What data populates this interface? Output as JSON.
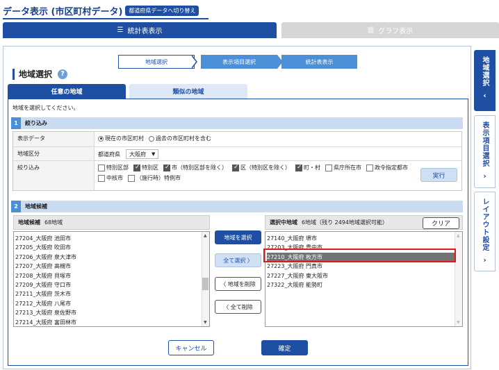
{
  "header": {
    "title": "データ表示 (市区町村データ)",
    "switch_button": "都道府県データへ切り替え"
  },
  "top_tabs": {
    "table": "統計表表示",
    "graph": "グラフ表示"
  },
  "steps": [
    "地域選択",
    "表示項目選択",
    "統計表表示"
  ],
  "area": {
    "title": "地域選択",
    "help": "?"
  },
  "sub_tabs": {
    "any": "任意の地域",
    "similar": "類似の地域"
  },
  "instruction": "地域を選択してください。",
  "section1": {
    "num": "1",
    "title": "絞り込み",
    "rows": {
      "data_label": "表示データ",
      "data_opt1": "現在の市区町村",
      "data_opt2": "過去の市区町村を含む",
      "type_label": "地域区分",
      "type_prefix": "都道府県",
      "type_select": "大阪府",
      "filter_label": "絞り込み",
      "filters": [
        {
          "label": "特別区部",
          "checked": false
        },
        {
          "label": "特別区",
          "checked": true
        },
        {
          "label": "市（特別区部を除く）",
          "checked": true
        },
        {
          "label": "区（特別区を除く）",
          "checked": true
        },
        {
          "label": "町・村",
          "checked": true
        },
        {
          "label": "県庁所在市",
          "checked": false
        },
        {
          "label": "政令指定都市",
          "checked": false
        },
        {
          "label": "中核市",
          "checked": false
        },
        {
          "label": "（施行時）特例市",
          "checked": false
        }
      ],
      "execute": "実行"
    }
  },
  "section2": {
    "num": "2",
    "title": "地域候補",
    "candidates_head": "地域候補",
    "candidates_count": "68地域",
    "candidates": [
      "27204_大阪府 池田市",
      "27205_大阪府 吹田市",
      "27206_大阪府 泉大津市",
      "27207_大阪府 高槻市",
      "27208_大阪府 貝塚市",
      "27209_大阪府 守口市",
      "27211_大阪府 茨木市",
      "27212_大阪府 八尾市",
      "27213_大阪府 泉佐野市",
      "27214_大阪府 富田林市"
    ],
    "selected_head": "選択中地域",
    "selected_count": "6地域（残り 2494地域選択可能）",
    "clear": "クリア",
    "selected": [
      "27140_大阪府 堺市",
      "27203_大阪府 豊中市",
      "27210_大阪府 枚方市",
      "27223_大阪府 門真市",
      "27227_大阪府 東大阪市",
      "27322_大阪府 能勢町"
    ],
    "add": "地域を選択",
    "select_all": "全て選択 〉",
    "remove": "〈 地域を削除",
    "remove_all": "〈 全て削除"
  },
  "footer": {
    "cancel": "キャンセル",
    "ok": "確定"
  },
  "side_tabs": {
    "area": "地域選択",
    "items": "表示項目選択",
    "layout": "レイアウト設定"
  },
  "colors": {
    "primary": "#1f4fa3",
    "accent": "#4b8fd6",
    "highlight": "#e01818"
  }
}
